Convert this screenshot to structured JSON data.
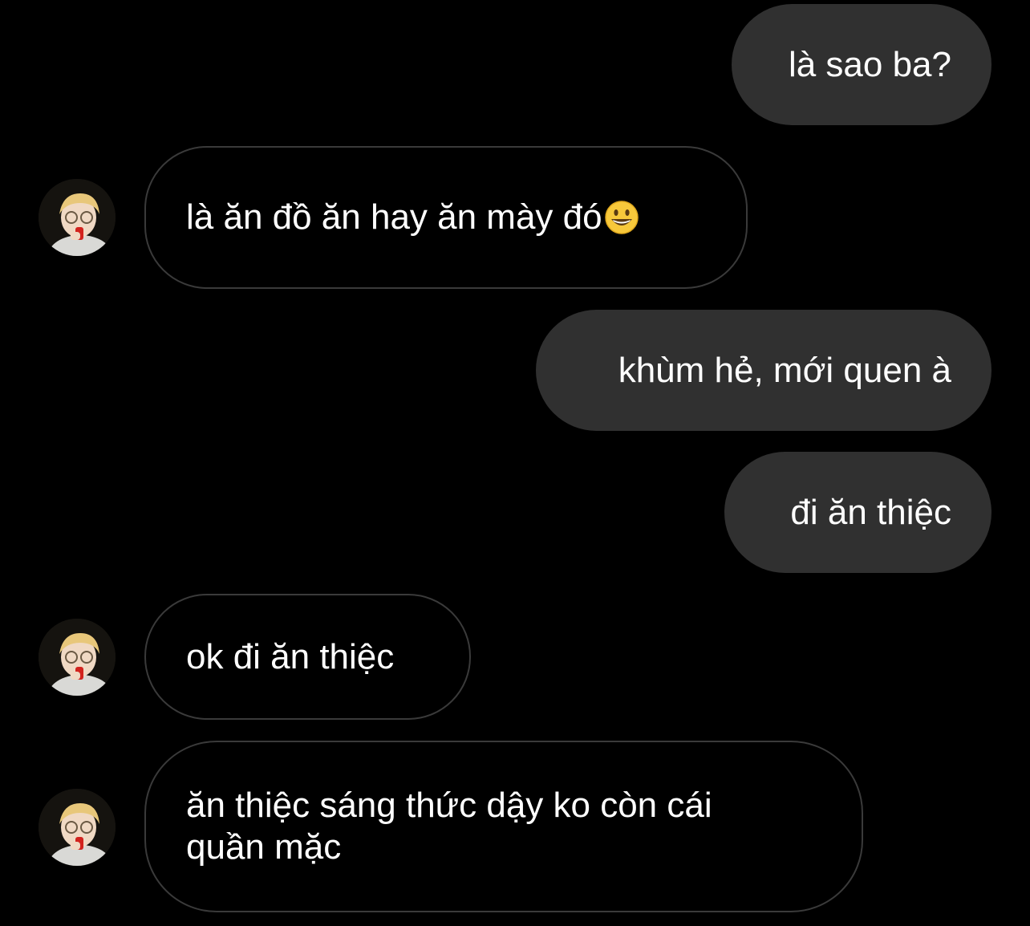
{
  "conversation": {
    "messages": [
      {
        "from": "me",
        "text": "là sao ba?"
      },
      {
        "from": "them",
        "text": "là ăn đồ ăn hay ăn mày đó",
        "emoji": "grinning-face-emoji"
      },
      {
        "from": "me",
        "text": "khùm hẻ, mới quen à"
      },
      {
        "from": "me",
        "text": "đi ăn thiệc"
      },
      {
        "from": "them",
        "text": "ok đi ăn thiệc"
      },
      {
        "from": "them",
        "text": "ăn thiệc sáng thức dậy ko còn cái\nquần mặc"
      }
    ]
  },
  "theme": {
    "background": "#000000",
    "sent_bubble": "#303030",
    "received_border": "#3a3a3a",
    "text": "#ffffff"
  }
}
